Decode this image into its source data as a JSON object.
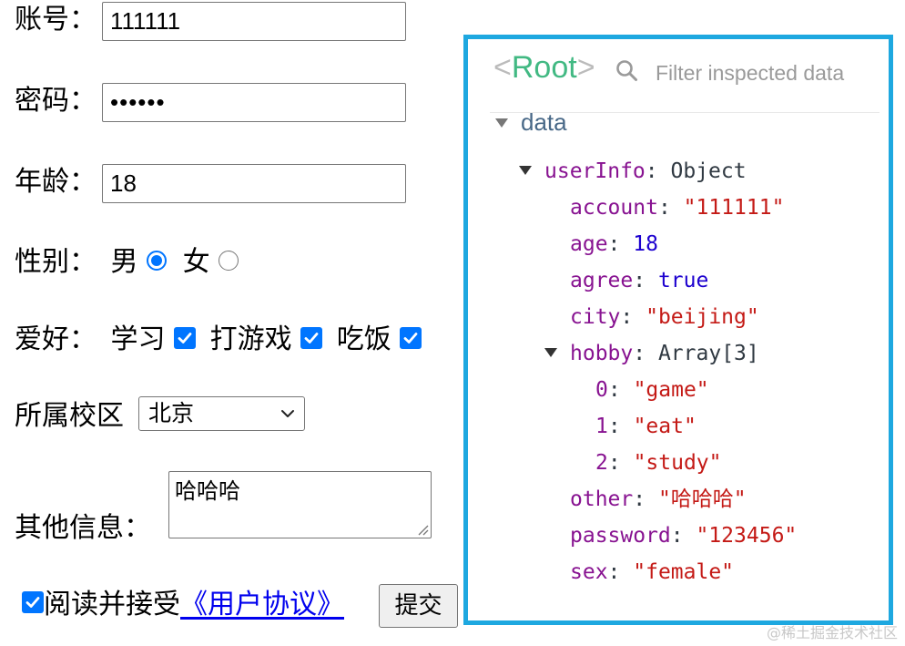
{
  "form": {
    "account": {
      "label": "账号：",
      "value": "111111"
    },
    "password": {
      "label": "密码：",
      "value": "••••••"
    },
    "age": {
      "label": "年龄：",
      "value": "18"
    },
    "sex": {
      "label": "性别：",
      "options": [
        "男",
        "女"
      ],
      "selected": "男"
    },
    "hobby": {
      "label": "爱好：",
      "options": [
        "学习",
        "打游戏",
        "吃饭"
      ],
      "checked": [
        true,
        true,
        true
      ]
    },
    "city": {
      "label": "所属校区",
      "selected": "北京"
    },
    "other": {
      "label": "其他信息：",
      "value": "哈哈哈"
    },
    "agree": {
      "text": "阅读并接受",
      "link": "《用户协议》",
      "checked": true
    },
    "submit_label": "提交"
  },
  "inspector": {
    "root_open": "<",
    "root_name": "Root",
    "root_close": ">",
    "filter_placeholder": "Filter inspected data",
    "section": "data",
    "tree": {
      "userInfo": {
        "key": "userInfo",
        "type": "Object"
      },
      "account": {
        "key": "account",
        "value": "\"111111\""
      },
      "age": {
        "key": "age",
        "value": "18"
      },
      "agree": {
        "key": "agree",
        "value": "true"
      },
      "city": {
        "key": "city",
        "value": "\"beijing\""
      },
      "hobby": {
        "key": "hobby",
        "type": "Array[3]"
      },
      "hobby_items": [
        {
          "key": "0",
          "value": "\"game\""
        },
        {
          "key": "1",
          "value": "\"eat\""
        },
        {
          "key": "2",
          "value": "\"study\""
        }
      ],
      "other": {
        "key": "other",
        "value": "\"哈哈哈\""
      },
      "password": {
        "key": "password",
        "value": "\"123456\""
      },
      "sex": {
        "key": "sex",
        "value": "\"female\""
      }
    },
    "colors": {
      "border": "#1ea8e0",
      "root": "#42b983",
      "key": "#881391",
      "string": "#c41a16",
      "number": "#1c00cf"
    }
  },
  "watermark": "@稀土掘金技术社区"
}
